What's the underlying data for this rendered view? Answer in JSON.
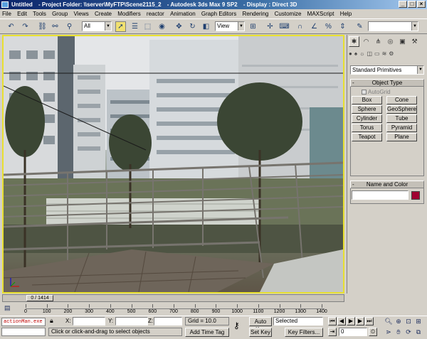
{
  "window": {
    "title_parts": [
      "Untitled",
      "- Project Folder: \\\\server\\MyFTP\\Scene2115_2",
      "- Autodesk 3ds Max 9 SP2",
      "- Display : Direct 3D"
    ],
    "buttons": [
      "_",
      "□",
      "×"
    ]
  },
  "menu": [
    "File",
    "Edit",
    "Tools",
    "Group",
    "Views",
    "Create",
    "Modifiers",
    "reactor",
    "Animation",
    "Graph Editors",
    "Rendering",
    "Customize",
    "MAXScript",
    "Help"
  ],
  "toolbar": {
    "selection_filter": "All",
    "ref_coord": "View",
    "named_sel_placeholder": ""
  },
  "viewport": {
    "label": "",
    "border_color": "#e8e030"
  },
  "command_panel": {
    "category": "Standard Primitives",
    "object_type_title": "Object Type",
    "autogrid_label": "AutoGrid",
    "primitives": [
      "Box",
      "Cone",
      "Sphere",
      "GeoSphere",
      "Cylinder",
      "Tube",
      "Torus",
      "Pyramid",
      "Teapot",
      "Plane"
    ],
    "name_color_title": "Name and Color",
    "object_name": "",
    "object_color": "#a00030"
  },
  "timeline": {
    "frame_counter": "0 / 1414",
    "ticks": [
      "0",
      "100",
      "200",
      "300",
      "400",
      "500",
      "600",
      "700",
      "800",
      "900",
      "1000",
      "1100",
      "1200",
      "1300",
      "1400"
    ]
  },
  "status": {
    "listener_text": "actionMan.exe",
    "prompt": "Click or click-and-drag to select objects",
    "x_label": "X:",
    "y_label": "Y:",
    "z_label": "Z:",
    "grid": "Grid = 10.0",
    "auto_key": "Auto Key",
    "set_key": "Set Key",
    "key_mode": "Selected",
    "key_filters": "Key Filters...",
    "add_time_tag": "Add Time Tag",
    "current_frame": "0"
  }
}
